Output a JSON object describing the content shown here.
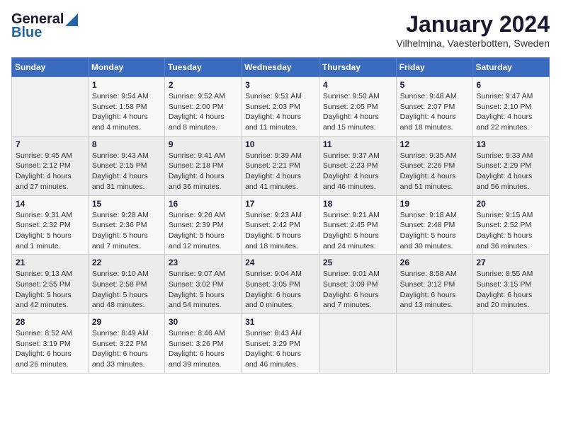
{
  "header": {
    "logo_general": "General",
    "logo_blue": "Blue",
    "title": "January 2024",
    "subtitle": "Vilhelmina, Vaesterbotten, Sweden"
  },
  "calendar": {
    "days_of_week": [
      "Sunday",
      "Monday",
      "Tuesday",
      "Wednesday",
      "Thursday",
      "Friday",
      "Saturday"
    ],
    "weeks": [
      [
        {
          "day": "",
          "info": ""
        },
        {
          "day": "1",
          "info": "Sunrise: 9:54 AM\nSunset: 1:58 PM\nDaylight: 4 hours\nand 4 minutes."
        },
        {
          "day": "2",
          "info": "Sunrise: 9:52 AM\nSunset: 2:00 PM\nDaylight: 4 hours\nand 8 minutes."
        },
        {
          "day": "3",
          "info": "Sunrise: 9:51 AM\nSunset: 2:03 PM\nDaylight: 4 hours\nand 11 minutes."
        },
        {
          "day": "4",
          "info": "Sunrise: 9:50 AM\nSunset: 2:05 PM\nDaylight: 4 hours\nand 15 minutes."
        },
        {
          "day": "5",
          "info": "Sunrise: 9:48 AM\nSunset: 2:07 PM\nDaylight: 4 hours\nand 18 minutes."
        },
        {
          "day": "6",
          "info": "Sunrise: 9:47 AM\nSunset: 2:10 PM\nDaylight: 4 hours\nand 22 minutes."
        }
      ],
      [
        {
          "day": "7",
          "info": "Sunrise: 9:45 AM\nSunset: 2:12 PM\nDaylight: 4 hours\nand 27 minutes."
        },
        {
          "day": "8",
          "info": "Sunrise: 9:43 AM\nSunset: 2:15 PM\nDaylight: 4 hours\nand 31 minutes."
        },
        {
          "day": "9",
          "info": "Sunrise: 9:41 AM\nSunset: 2:18 PM\nDaylight: 4 hours\nand 36 minutes."
        },
        {
          "day": "10",
          "info": "Sunrise: 9:39 AM\nSunset: 2:21 PM\nDaylight: 4 hours\nand 41 minutes."
        },
        {
          "day": "11",
          "info": "Sunrise: 9:37 AM\nSunset: 2:23 PM\nDaylight: 4 hours\nand 46 minutes."
        },
        {
          "day": "12",
          "info": "Sunrise: 9:35 AM\nSunset: 2:26 PM\nDaylight: 4 hours\nand 51 minutes."
        },
        {
          "day": "13",
          "info": "Sunrise: 9:33 AM\nSunset: 2:29 PM\nDaylight: 4 hours\nand 56 minutes."
        }
      ],
      [
        {
          "day": "14",
          "info": "Sunrise: 9:31 AM\nSunset: 2:32 PM\nDaylight: 5 hours\nand 1 minute."
        },
        {
          "day": "15",
          "info": "Sunrise: 9:28 AM\nSunset: 2:36 PM\nDaylight: 5 hours\nand 7 minutes."
        },
        {
          "day": "16",
          "info": "Sunrise: 9:26 AM\nSunset: 2:39 PM\nDaylight: 5 hours\nand 12 minutes."
        },
        {
          "day": "17",
          "info": "Sunrise: 9:23 AM\nSunset: 2:42 PM\nDaylight: 5 hours\nand 18 minutes."
        },
        {
          "day": "18",
          "info": "Sunrise: 9:21 AM\nSunset: 2:45 PM\nDaylight: 5 hours\nand 24 minutes."
        },
        {
          "day": "19",
          "info": "Sunrise: 9:18 AM\nSunset: 2:48 PM\nDaylight: 5 hours\nand 30 minutes."
        },
        {
          "day": "20",
          "info": "Sunrise: 9:15 AM\nSunset: 2:52 PM\nDaylight: 5 hours\nand 36 minutes."
        }
      ],
      [
        {
          "day": "21",
          "info": "Sunrise: 9:13 AM\nSunset: 2:55 PM\nDaylight: 5 hours\nand 42 minutes."
        },
        {
          "day": "22",
          "info": "Sunrise: 9:10 AM\nSunset: 2:58 PM\nDaylight: 5 hours\nand 48 minutes."
        },
        {
          "day": "23",
          "info": "Sunrise: 9:07 AM\nSunset: 3:02 PM\nDaylight: 5 hours\nand 54 minutes."
        },
        {
          "day": "24",
          "info": "Sunrise: 9:04 AM\nSunset: 3:05 PM\nDaylight: 6 hours\nand 0 minutes."
        },
        {
          "day": "25",
          "info": "Sunrise: 9:01 AM\nSunset: 3:09 PM\nDaylight: 6 hours\nand 7 minutes."
        },
        {
          "day": "26",
          "info": "Sunrise: 8:58 AM\nSunset: 3:12 PM\nDaylight: 6 hours\nand 13 minutes."
        },
        {
          "day": "27",
          "info": "Sunrise: 8:55 AM\nSunset: 3:15 PM\nDaylight: 6 hours\nand 20 minutes."
        }
      ],
      [
        {
          "day": "28",
          "info": "Sunrise: 8:52 AM\nSunset: 3:19 PM\nDaylight: 6 hours\nand 26 minutes."
        },
        {
          "day": "29",
          "info": "Sunrise: 8:49 AM\nSunset: 3:22 PM\nDaylight: 6 hours\nand 33 minutes."
        },
        {
          "day": "30",
          "info": "Sunrise: 8:46 AM\nSunset: 3:26 PM\nDaylight: 6 hours\nand 39 minutes."
        },
        {
          "day": "31",
          "info": "Sunrise: 8:43 AM\nSunset: 3:29 PM\nDaylight: 6 hours\nand 46 minutes."
        },
        {
          "day": "",
          "info": ""
        },
        {
          "day": "",
          "info": ""
        },
        {
          "day": "",
          "info": ""
        }
      ]
    ]
  }
}
